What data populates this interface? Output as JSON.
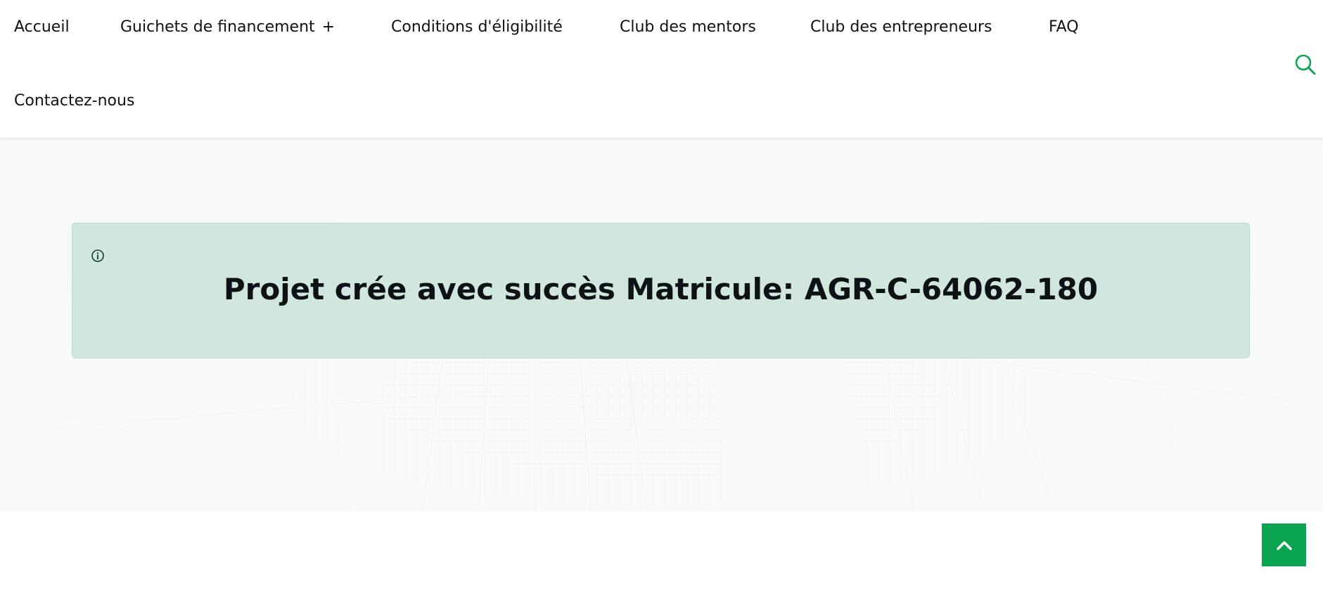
{
  "nav": {
    "items": [
      {
        "label": "Accueil"
      },
      {
        "label": "Guichets de financement",
        "suffix": "+"
      },
      {
        "label": "Conditions d'éligibilité"
      },
      {
        "label": "Club des mentors"
      },
      {
        "label": "Club des entrepreneurs"
      },
      {
        "label": "FAQ"
      },
      {
        "label": "Contactez-nous"
      }
    ],
    "search_icon": "search-icon"
  },
  "alert": {
    "icon": "info-circle-icon",
    "message": "Projet crée avec succès Matricule: AGR-C-64062-180"
  },
  "back_to_top": {
    "icon": "chevron-up-icon"
  },
  "colors": {
    "accent": "#0aa34f",
    "alert_background": "#d1e7dd",
    "alert_border": "#badbcc",
    "text": "#111111"
  }
}
